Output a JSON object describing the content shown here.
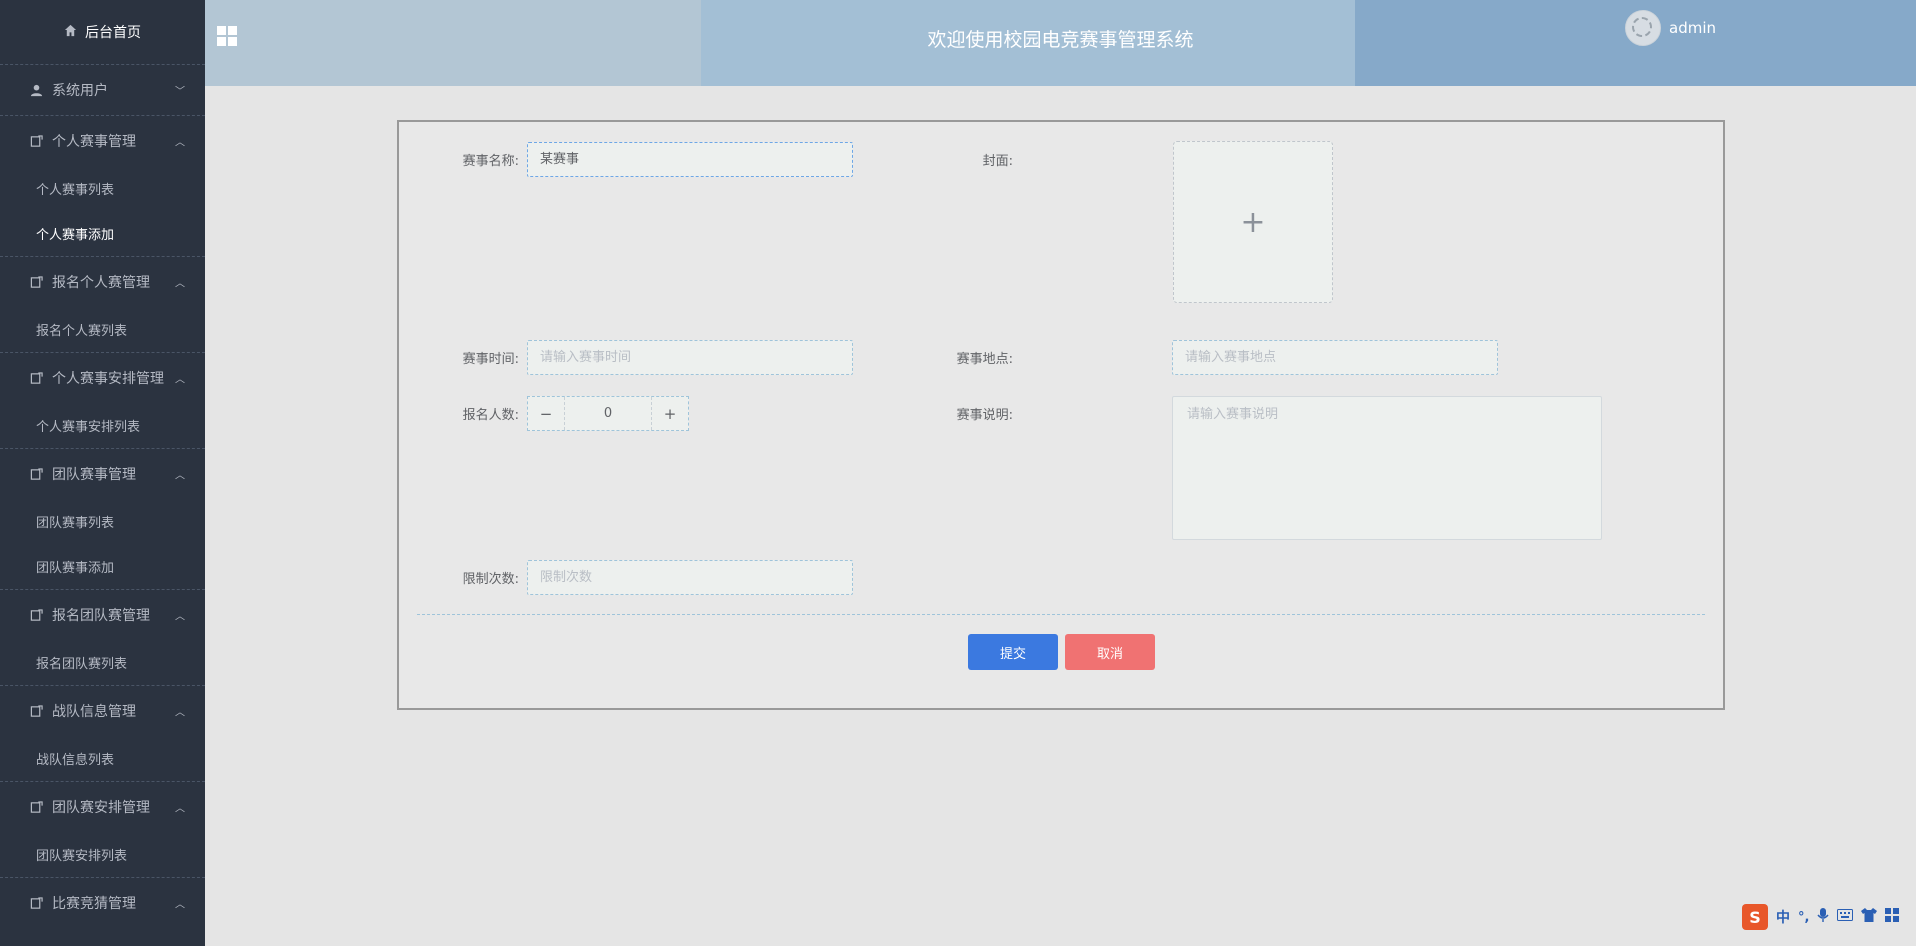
{
  "sidebar": {
    "home": "后台首页",
    "groups": [
      {
        "label": "系统用户",
        "expanded": false,
        "items": []
      },
      {
        "label": "个人赛事管理",
        "expanded": true,
        "items": [
          "个人赛事列表",
          "个人赛事添加"
        ]
      },
      {
        "label": "报名个人赛管理",
        "expanded": true,
        "items": [
          "报名个人赛列表"
        ]
      },
      {
        "label": "个人赛事安排管理",
        "expanded": true,
        "items": [
          "个人赛事安排列表"
        ]
      },
      {
        "label": "团队赛事管理",
        "expanded": true,
        "items": [
          "团队赛事列表",
          "团队赛事添加"
        ]
      },
      {
        "label": "报名团队赛管理",
        "expanded": true,
        "items": [
          "报名团队赛列表"
        ]
      },
      {
        "label": "战队信息管理",
        "expanded": true,
        "items": [
          "战队信息列表"
        ]
      },
      {
        "label": "团队赛安排管理",
        "expanded": true,
        "items": [
          "团队赛安排列表"
        ]
      },
      {
        "label": "比赛竞猜管理",
        "expanded": true,
        "items": []
      }
    ],
    "active_item": "个人赛事添加"
  },
  "header": {
    "title": "欢迎使用校园电竞赛事管理系统",
    "username": "admin"
  },
  "form": {
    "name_label": "赛事名称:",
    "name_value": "某赛事",
    "cover_label": "封面:",
    "cover_plus": "+",
    "time_label": "赛事时间:",
    "time_placeholder": "请输入赛事时间",
    "place_label": "赛事地点:",
    "place_placeholder": "请输入赛事地点",
    "count_label": "报名人数:",
    "count_value": "0",
    "count_minus": "−",
    "count_plus": "+",
    "desc_label": "赛事说明:",
    "desc_placeholder": "请输入赛事说明",
    "limit_label": "限制次数:",
    "limit_placeholder": "限制次数",
    "submit": "提交",
    "cancel": "取消"
  },
  "ime": {
    "logo": "S",
    "mode": "中"
  },
  "colors": {
    "sidebar_bg": "#2b3340",
    "submit": "#3b79e0",
    "cancel": "#f07272"
  }
}
